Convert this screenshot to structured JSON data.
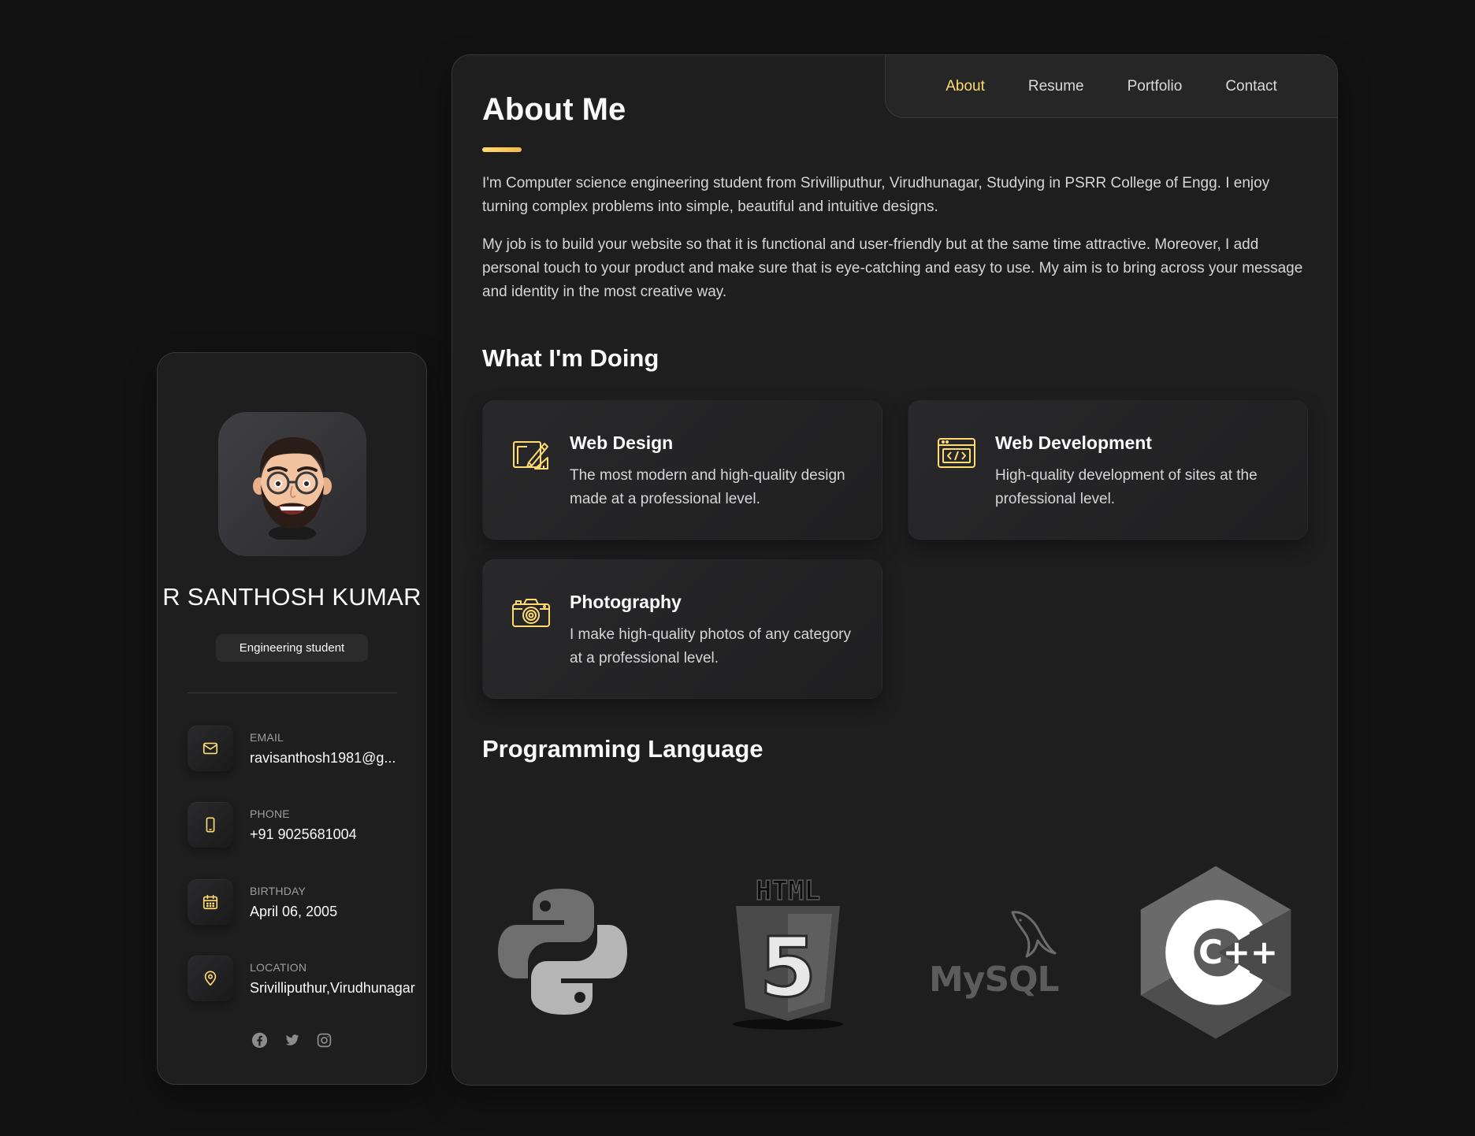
{
  "profile": {
    "name": "R SANTHOSH KUMAR",
    "title": "Engineering student",
    "contacts": [
      {
        "label": "EMAIL",
        "value": "ravisanthosh1981@g...",
        "icon": "mail-icon"
      },
      {
        "label": "PHONE",
        "value": "+91 9025681004",
        "icon": "phone-icon"
      },
      {
        "label": "BIRTHDAY",
        "value": "April 06, 2005",
        "icon": "calendar-icon"
      },
      {
        "label": "LOCATION",
        "value": "Srivilliputhur,Virudhunagar",
        "icon": "location-pin-icon"
      }
    ],
    "socials": [
      "facebook-icon",
      "twitter-icon",
      "instagram-icon"
    ]
  },
  "nav": {
    "items": [
      "About",
      "Resume",
      "Portfolio",
      "Contact"
    ],
    "active": "About"
  },
  "about": {
    "title": "About Me",
    "paragraphs": [
      "I'm Computer science engineering student from Srivilliputhur, Virudhunagar, Studying in PSRR College of Engg. I enjoy turning complex problems into simple, beautiful and intuitive designs.",
      "My job is to build your website so that it is functional and user-friendly but at the same time attractive. Moreover, I add personal touch to your product and make sure that is eye-catching and easy to use. My aim is to bring across your message and identity in the most creative way."
    ]
  },
  "services": {
    "title": "What I'm Doing",
    "items": [
      {
        "title": "Web Design",
        "text": "The most modern and high-quality design made at a professional level.",
        "icon": "design-icon"
      },
      {
        "title": "Web Development",
        "text": "High-quality development of sites at the professional level.",
        "icon": "code-icon"
      },
      {
        "title": "Photography",
        "text": "I make high-quality photos of any category at a professional level.",
        "icon": "camera-icon"
      }
    ]
  },
  "languages": {
    "title": "Programming Language",
    "items": [
      {
        "name": "Python",
        "icon": "python-logo"
      },
      {
        "name": "HTML5",
        "icon": "html5-logo",
        "logo_text": "HTML",
        "logo_number": "5"
      },
      {
        "name": "MySQL",
        "icon": "mysql-logo",
        "logo_text": "MySQL"
      },
      {
        "name": "C++",
        "icon": "cpp-logo",
        "logo_text": "C++"
      }
    ]
  },
  "colors": {
    "accent": "#ffdb70",
    "background": "#121212",
    "card": "#1e1e1f",
    "border": "#383838"
  }
}
